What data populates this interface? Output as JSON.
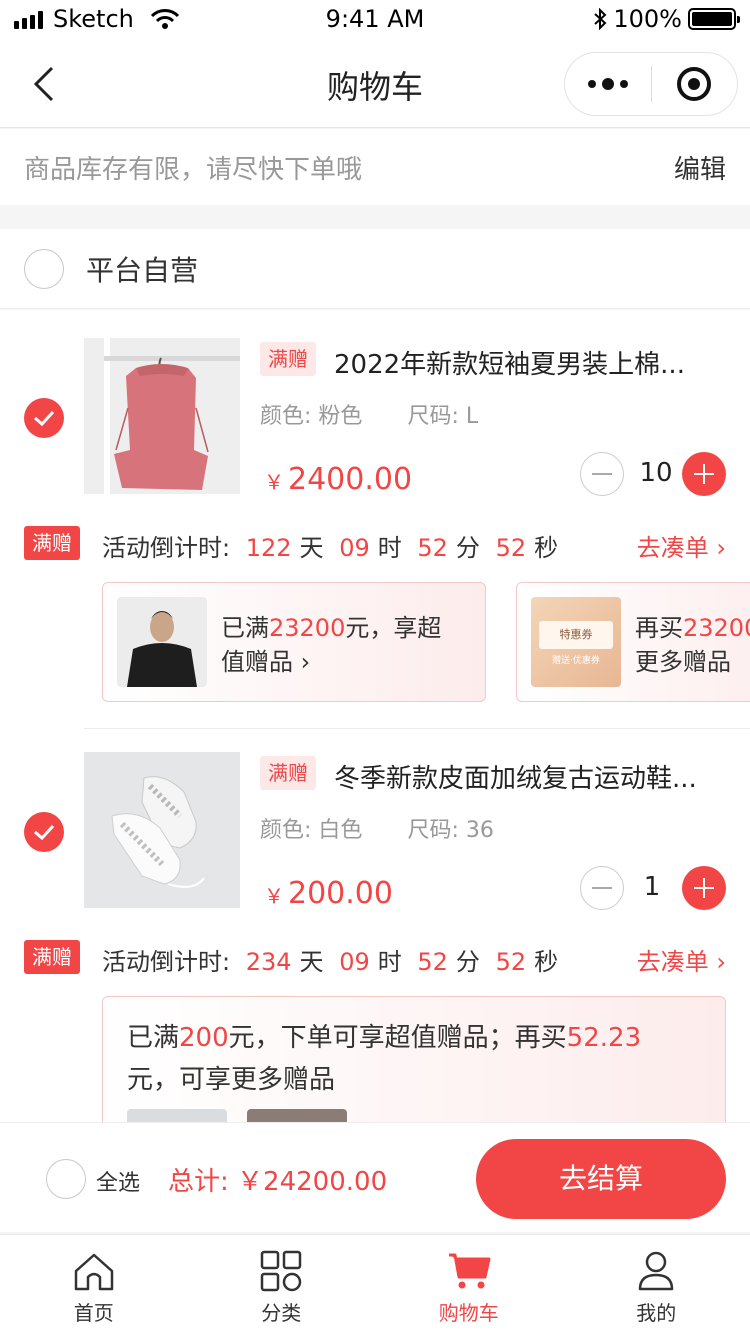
{
  "status_bar": {
    "carrier": "Sketch",
    "time": "9:41 AM",
    "battery": "100%"
  },
  "nav": {
    "title": "购物车"
  },
  "notice": {
    "tip": "商品库存有限，请尽快下单哦",
    "edit": "编辑"
  },
  "shop": {
    "name": "平台自营"
  },
  "items": [
    {
      "tag": "满赠",
      "title": "2022年新款短袖夏男装上棉...",
      "color_label": "颜色:",
      "color": "粉色",
      "size_label": "尺码:",
      "size": "L",
      "currency": "￥",
      "price": "2400.00",
      "quantity": "10",
      "checked": true,
      "promo": {
        "badge": "满赠",
        "countdown_label": "活动倒计时:",
        "days": "122",
        "day_unit": "天",
        "hours": "09",
        "hour_unit": "时",
        "minutes": "52",
        "minute_unit": "分",
        "seconds": "52",
        "second_unit": "秒",
        "more": "去凑单"
      },
      "gift_cards": [
        {
          "prefix": "已满",
          "amount": "23200",
          "suffix": "元，享超",
          "line2": "值赠品"
        },
        {
          "prefix": "再买",
          "amount": "23200",
          "line2": "更多赠品",
          "coupon_title": "特惠券",
          "coupon_sub": "赠送·优惠券"
        }
      ]
    },
    {
      "tag": "满赠",
      "title": "冬季新款皮面加绒复古运动鞋...",
      "color_label": "颜色:",
      "color": "白色",
      "size_label": "尺码:",
      "size": "36",
      "currency": "￥",
      "price": "200.00",
      "quantity": "1",
      "checked": true,
      "promo": {
        "badge": "满赠",
        "countdown_label": "活动倒计时:",
        "days": "234",
        "day_unit": "天",
        "hours": "09",
        "hour_unit": "时",
        "minutes": "52",
        "minute_unit": "分",
        "seconds": "52",
        "second_unit": "秒",
        "more": "去凑单"
      },
      "promo_text": {
        "p1": "已满",
        "a1": "200",
        "p2": "元，下单可享超值赠品；再买",
        "a2": "52.23",
        "p3": "元，可享更多赠品"
      }
    }
  ],
  "checkout": {
    "select_all": "全选",
    "total_label": "总计:",
    "currency": "￥",
    "total": "24200.00",
    "button": "去结算"
  },
  "tabbar": [
    {
      "label": "首页",
      "icon": "home-icon",
      "active": false
    },
    {
      "label": "分类",
      "icon": "category-icon",
      "active": false
    },
    {
      "label": "购物车",
      "icon": "cart-icon",
      "active": true
    },
    {
      "label": "我的",
      "icon": "profile-icon",
      "active": false
    }
  ],
  "colors": {
    "accent": "#f24646",
    "tag_bg": "#fde8e8",
    "muted": "#999999"
  }
}
